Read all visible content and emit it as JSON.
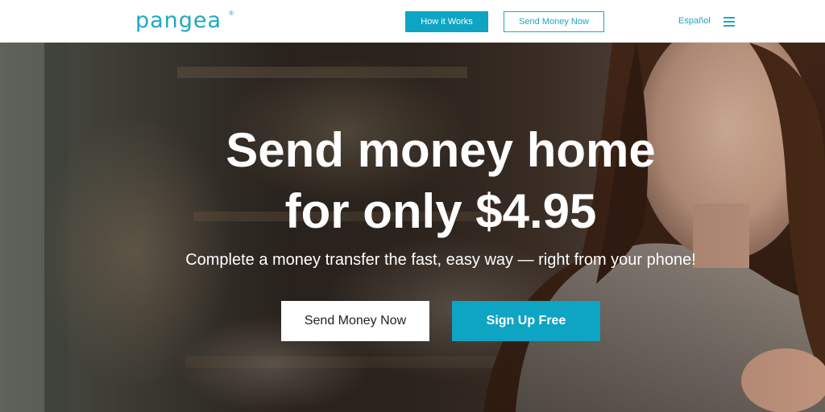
{
  "header": {
    "logo_text": "pangea",
    "logo_mark": "®",
    "nav": {
      "how_it_works": "How it Works",
      "send_money_now": "Send Money Now"
    },
    "language_link": "Español",
    "menu_icon": "hamburger-menu-icon"
  },
  "hero": {
    "title_line1": "Send money home",
    "title_line2": "for only $4.95",
    "subtitle": "Complete a money transfer the fast, easy way — right from your phone!",
    "buttons": {
      "send_money_now": "Send Money Now",
      "sign_up_free": "Sign Up Free"
    }
  },
  "colors": {
    "brand_teal": "#0ea4c4",
    "white": "#ffffff",
    "text_dark": "#222222"
  }
}
